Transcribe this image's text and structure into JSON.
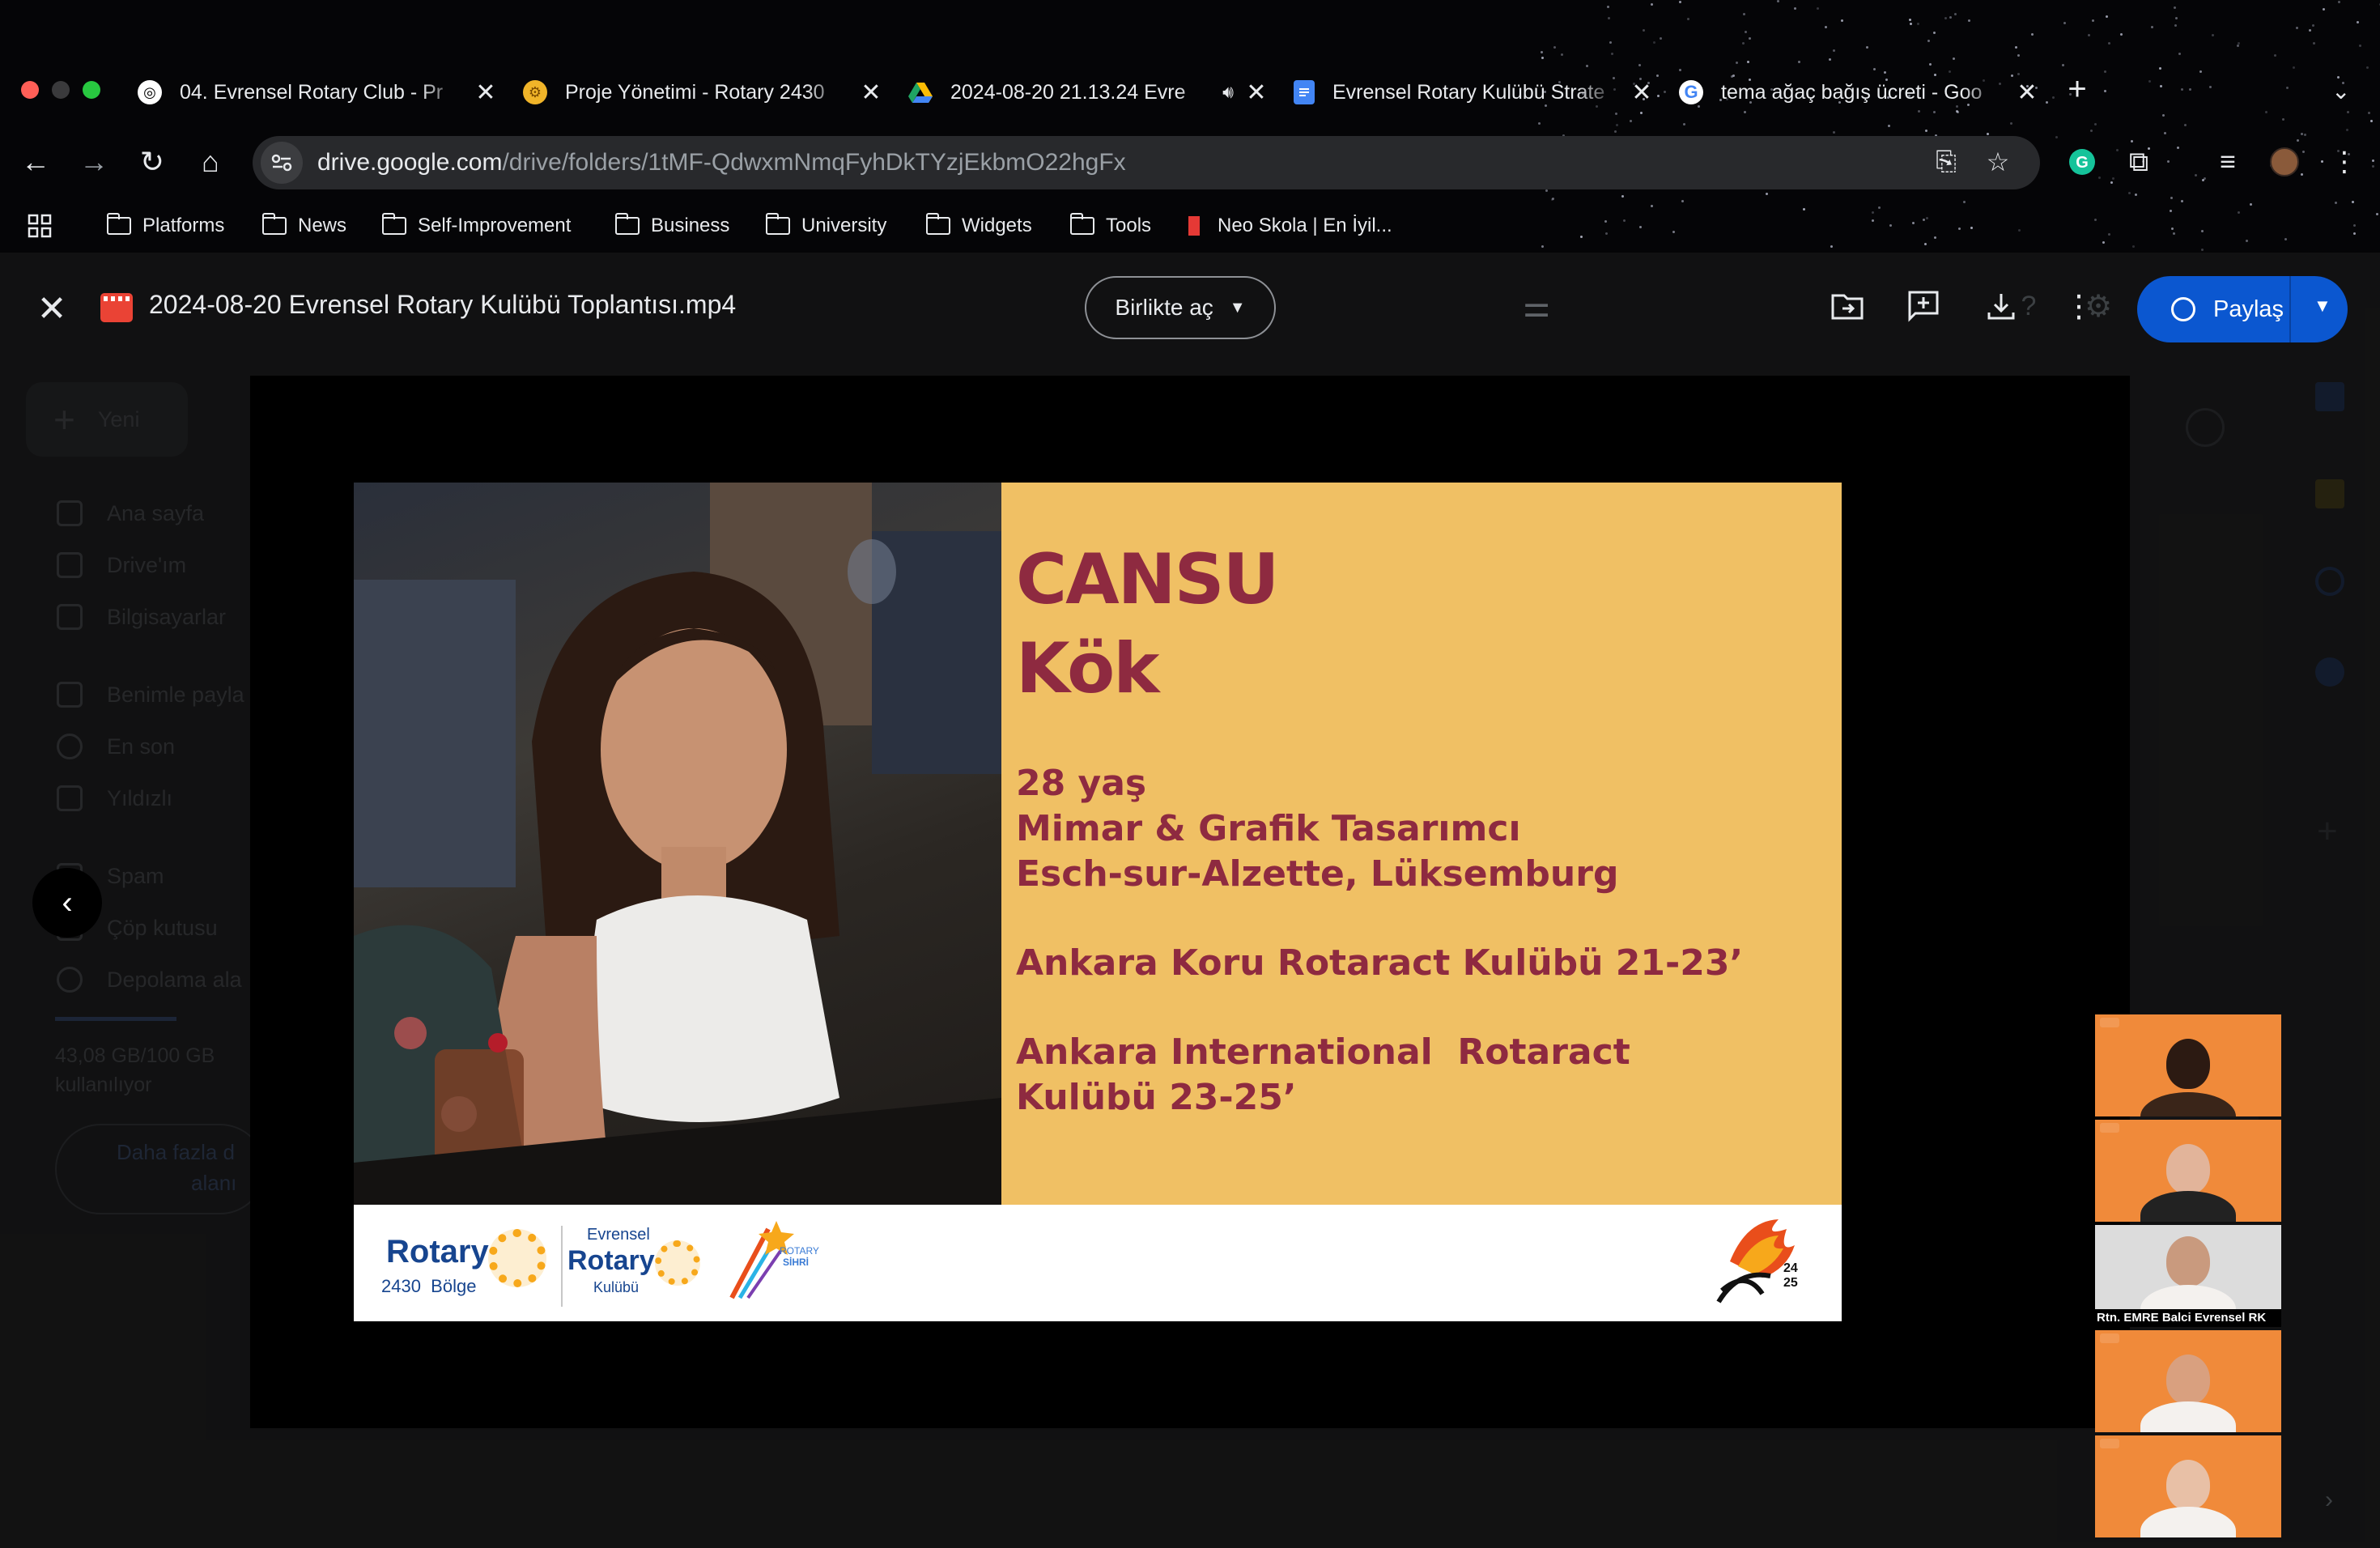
{
  "browser": {
    "tabs": [
      {
        "title": "04. Evrensel Rotary Club - Pr",
        "icon": "openai-icon"
      },
      {
        "title": "Proje Yönetimi - Rotary 2430",
        "icon": "rotary-wheel-icon"
      },
      {
        "title": "2024-08-20 21.13.24 Evre",
        "icon": "google-drive-icon",
        "audio": true
      },
      {
        "title": "Evrensel Rotary Kulübü Strate",
        "icon": "google-docs-icon"
      },
      {
        "title": "tema ağaç bağış ücreti - Goo",
        "icon": "google-icon"
      }
    ],
    "url_host": "drive.google.com",
    "url_path": "/drive/folders/1tMF-QdwxmNmqFyhDkTYzjEkbmO22hgFx",
    "bookmarks": [
      "Platforms",
      "News",
      "Self-Improvement",
      "Business",
      "University",
      "Widgets",
      "Tools",
      "Neo Skola | En İyil..."
    ]
  },
  "drive": {
    "new_label": "Yeni",
    "nav": [
      "Ana sayfa",
      "Drive'ım",
      "Bilgisayarlar",
      "Benimle payla",
      "En son",
      "Yıldızlı",
      "Spam",
      "Çöp kutusu",
      "Depolama ala"
    ],
    "storage_line1": "43,08 GB/100 GB",
    "storage_line2": "kullanılıyor",
    "upgrade_line1": "Daha fazla d",
    "upgrade_line2": "alanı"
  },
  "viewer": {
    "file_title": "2024-08-20 Evrensel Rotary Kulübü Toplantısı.mp4",
    "open_with_label": "Birlikte aç",
    "share_label": "Paylaş"
  },
  "slide": {
    "first_name": "CANSU",
    "last_name": "Kök",
    "age": "28 yaş",
    "profession": "Mimar & Grafik Tasarımcı",
    "location": "Esch-sur-Alzette, Lüksemburg",
    "club1": "Ankara Koru Rotaract Kulübü 21-23’",
    "club2_line1": "Ankara International  Rotaract",
    "club2_line2": "Kulübü 23-25’",
    "footer": {
      "rotary_word": "Rotary",
      "district": "2430  Bölge",
      "evrensel": "Evrensel",
      "rotary_word2": "Rotary",
      "kulubu": "Kulübü",
      "sihri_line1": "ROTARY",
      "sihri_line2": "SİHRİ",
      "year_mark": "24 25"
    },
    "participant_label": "Rtn. EMRE Balci Evrensel RK"
  },
  "colors": {
    "slide_panel": "#f0c064",
    "slide_text": "#8e2a40",
    "participant_bg": "#f08a3a",
    "share_button": "#0b57d0"
  }
}
